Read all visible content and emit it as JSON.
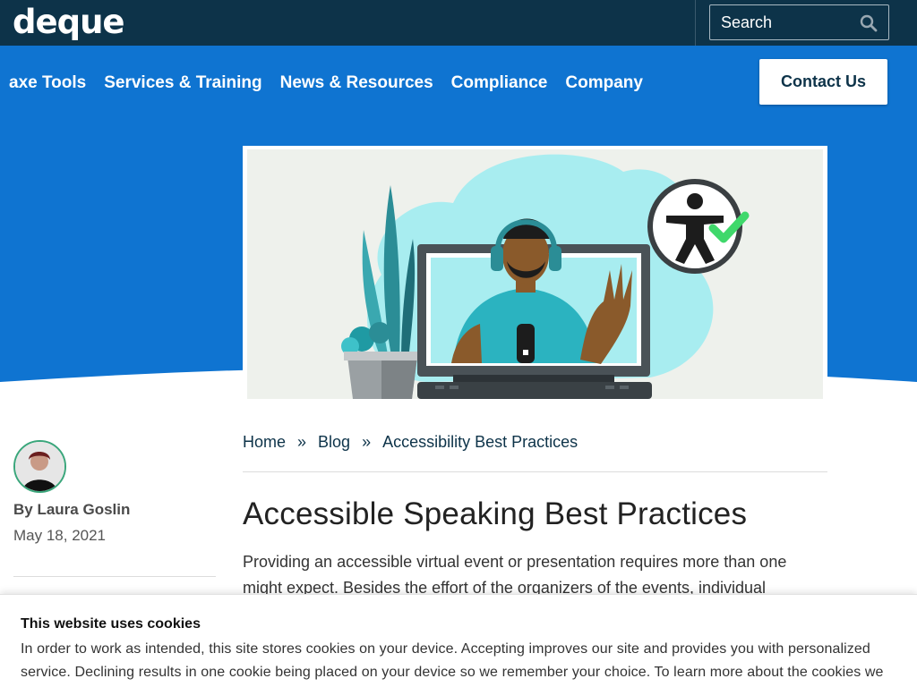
{
  "header": {
    "logo_text": "deque",
    "search_placeholder": "Search"
  },
  "nav": {
    "items": [
      {
        "label": "axe Tools"
      },
      {
        "label": "Services & Training"
      },
      {
        "label": "News & Resources"
      },
      {
        "label": "Compliance"
      },
      {
        "label": "Company"
      }
    ],
    "contact_label": "Contact Us"
  },
  "author": {
    "name": "By Laura Goslin",
    "date": "May 18, 2021"
  },
  "breadcrumb": {
    "home": "Home",
    "blog": "Blog",
    "category": "Accessibility Best Practices",
    "separator": "»"
  },
  "article": {
    "title": "Accessible Speaking Best Practices",
    "intro": "Providing an accessible virtual event or presentation requires more than one might expect. Besides the effort of the organizers of the events, individual"
  },
  "cookie_banner": {
    "title": "This website uses cookies",
    "text": "In order to work as intended, this site stores cookies on your device. Accepting improves our site and provides you with personalized service. Declining results in one cookie being placed on your device so we remember your choice. To learn more about the cookies we use,"
  },
  "colors": {
    "topbar": "#0d3349",
    "nav": "#0f74d1",
    "accent_green": "#3aa67b"
  }
}
